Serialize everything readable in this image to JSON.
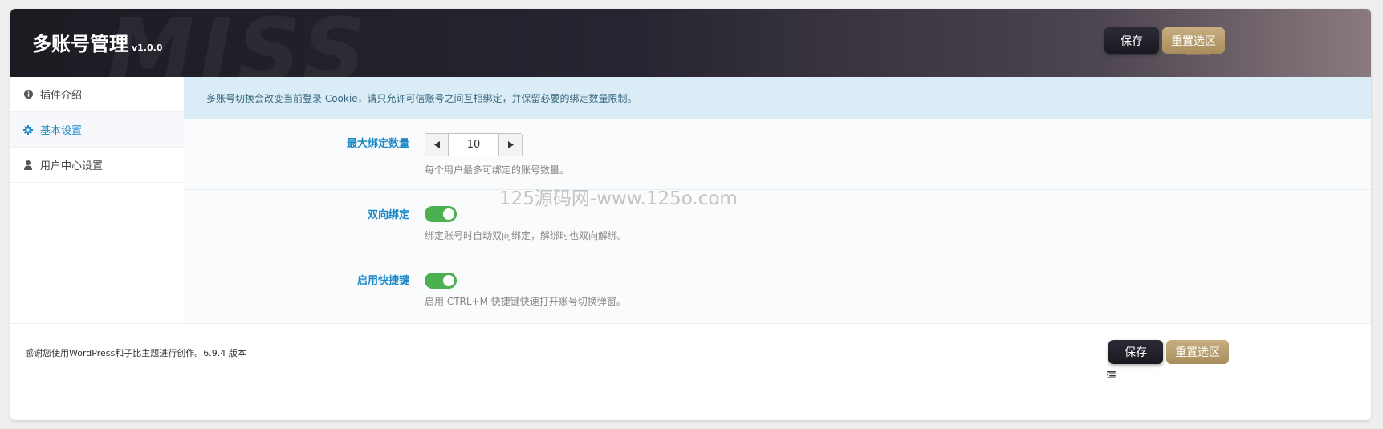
{
  "header": {
    "title": "多账号管理",
    "version": "v1.0.0",
    "bg_text": "MISS",
    "save_label": "保存",
    "reset_label": "重置选区"
  },
  "sidebar": {
    "items": [
      {
        "label": "插件介绍",
        "icon": "info-icon",
        "active": false
      },
      {
        "label": "基本设置",
        "icon": "gear-icon",
        "active": true
      },
      {
        "label": "用户中心设置",
        "icon": "user-icon",
        "active": false
      }
    ]
  },
  "notice": "多账号切换会改变当前登录 Cookie，请只允许可信账号之间互相绑定，并保留必要的绑定数量限制。",
  "fields": {
    "max_bind": {
      "label": "最大绑定数量",
      "value": "10",
      "desc": "每个用户最多可绑定的账号数量。"
    },
    "two_way": {
      "label": "双向绑定",
      "on": true,
      "desc": "绑定账号时自动双向绑定，解绑时也双向解绑。"
    },
    "hotkey": {
      "label": "启用快捷键",
      "on": true,
      "desc": "启用 CTRL+M 快捷键快速打开账号切换弹窗。"
    }
  },
  "footer": {
    "text": "感谢您使用WordPress和子比主题进行创作。6.9.4 版本",
    "save_label": "保存",
    "reset_label": "重置选区"
  },
  "watermark": "125源码网-www.125o.com",
  "colors": {
    "accent": "#1e88c7",
    "toggle_on": "#4caf50",
    "reset_gold": "#b89c6c",
    "header_dark": "#1d1b22"
  }
}
